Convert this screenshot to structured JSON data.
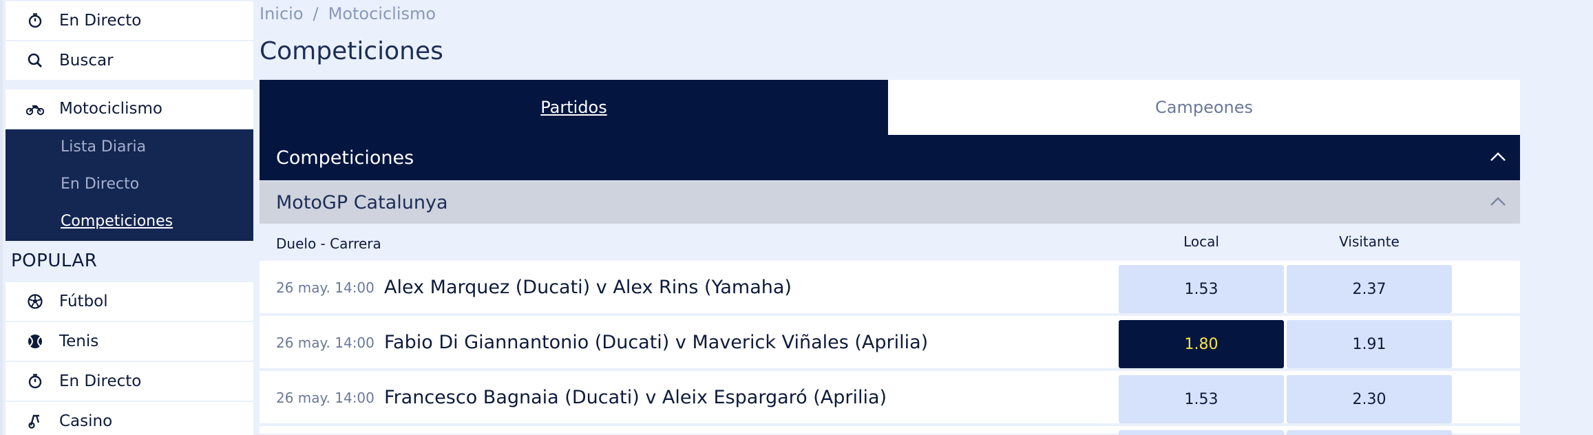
{
  "sidebar": {
    "top_items": [
      {
        "label": "En Directo",
        "icon": "stopwatch-icon"
      },
      {
        "label": "Buscar",
        "icon": "search-icon"
      }
    ],
    "sport": {
      "label": "Motociclismo",
      "icon": "motorcycle-icon"
    },
    "sub_items": [
      {
        "label": "Lista Diaria",
        "active": false
      },
      {
        "label": "En Directo",
        "active": false
      },
      {
        "label": "Competiciones",
        "active": true
      }
    ],
    "popular_title": "POPULAR",
    "popular_items": [
      {
        "label": "Fútbol",
        "icon": "soccer-ball-icon"
      },
      {
        "label": "Tenis",
        "icon": "tennis-ball-icon"
      },
      {
        "label": "En Directo",
        "icon": "stopwatch-icon"
      },
      {
        "label": "Casino",
        "icon": "cherries-icon"
      }
    ]
  },
  "breadcrumb": {
    "home": "Inicio",
    "separator": "/",
    "current": "Motociclismo"
  },
  "page_title": "Competiciones",
  "tabs": [
    {
      "label": "Partidos",
      "active": true
    },
    {
      "label": "Campeones",
      "active": false
    }
  ],
  "competitions_header": "Competiciones",
  "group_title": "MotoGP Catalunya",
  "market": {
    "name": "Duelo - Carrera",
    "col_local": "Local",
    "col_away": "Visitante"
  },
  "events": [
    {
      "time": "26 may. 14:00",
      "name": "Alex Marquez (Ducati) v Alex Rins (Yamaha)",
      "local": "1.53",
      "away": "2.37",
      "selected": "none"
    },
    {
      "time": "26 may. 14:00",
      "name": "Fabio Di Giannantonio (Ducati) v Maverick Viñales (Aprilia)",
      "local": "1.80",
      "away": "1.91",
      "selected": "local"
    },
    {
      "time": "26 may. 14:00",
      "name": "Francesco Bagnaia (Ducati) v Aleix Espargaró (Aprilia)",
      "local": "1.53",
      "away": "2.30",
      "selected": "none"
    }
  ],
  "colors": {
    "navy": "#041540",
    "sidebar_sub_bg": "#142652",
    "odds_bg": "#d6e1fb",
    "selected_text": "#f7e541",
    "page_bg": "#eaf0fc"
  }
}
